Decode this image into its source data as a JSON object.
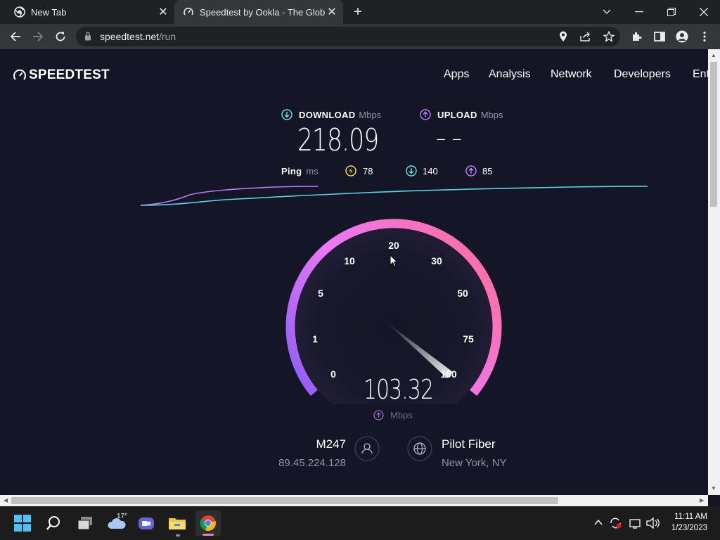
{
  "browser": {
    "tabs": [
      {
        "title": "New Tab",
        "icon": "chrome-icon"
      },
      {
        "title": "Speedtest by Ookla - The Global",
        "icon": "speedtest-icon"
      }
    ],
    "url_host": "speedtest.net",
    "url_path": "/run"
  },
  "site": {
    "logo_text": "SPEEDTEST",
    "nav": [
      "Apps",
      "Analysis",
      "Network",
      "Developers",
      "Ent"
    ]
  },
  "results": {
    "download_label": "DOWNLOAD",
    "download_unit": "Mbps",
    "download_value": "218.09",
    "upload_label": "UPLOAD",
    "upload_unit": "Mbps",
    "upload_value": "– –",
    "ping_label": "Ping",
    "ping_unit": "ms",
    "ping_idle": "78",
    "ping_download": "140",
    "ping_upload": "85"
  },
  "gauge": {
    "ticks": [
      "0",
      "1",
      "5",
      "10",
      "20",
      "30",
      "50",
      "75",
      "100"
    ],
    "value": "103.32",
    "unit": "Mbps",
    "needle_value": 100,
    "colors": {
      "start": "#8a5cf5",
      "mid": "#e879f9",
      "end": "#ff6fae"
    }
  },
  "connection": {
    "isp_name": "M247",
    "ip": "89.45.224.128",
    "server_name": "Pilot Fiber",
    "server_location": "New York, NY"
  },
  "colors": {
    "download_accent": "#6ee7e7",
    "upload_accent": "#c084fc",
    "ping_accent": "#fde047",
    "background": "#141526"
  },
  "taskbar": {
    "weather_temp": "17°",
    "time": "11:11 AM",
    "date": "1/23/2023"
  }
}
